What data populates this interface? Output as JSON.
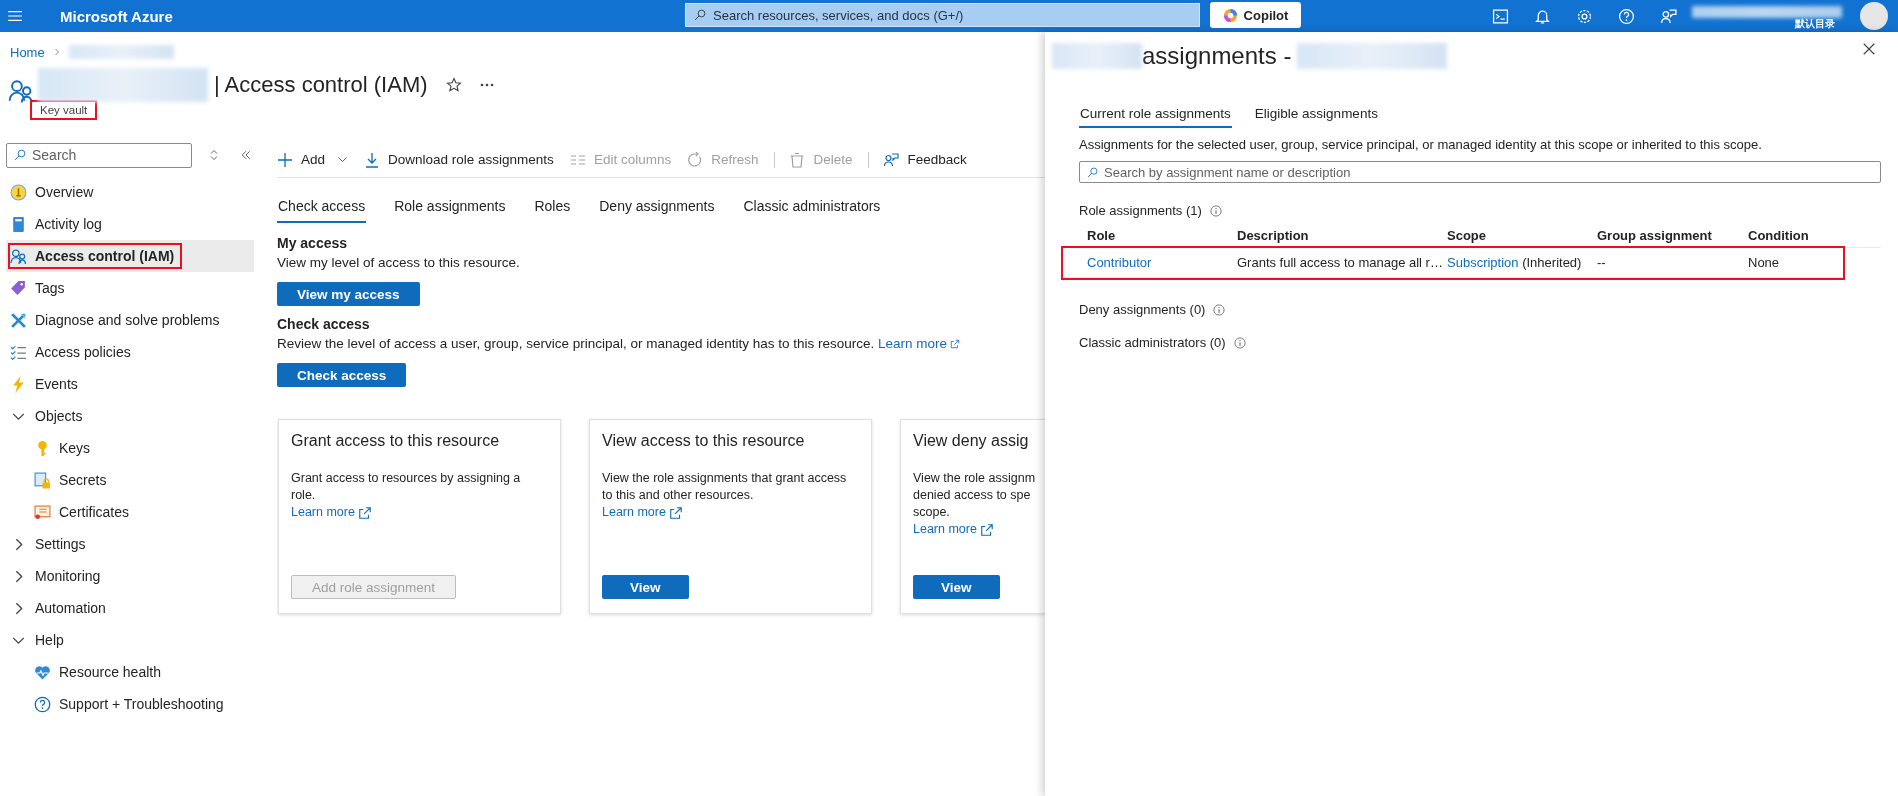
{
  "top_bar": {
    "brand": "Microsoft Azure",
    "search": {
      "placeholder": "Search resources, services, and docs (G+/)"
    },
    "copilot": "Copilot",
    "directory": "默认目录"
  },
  "breadcrumb": {
    "home": "Home"
  },
  "header": {
    "title": "| Access control (IAM)",
    "subtitle": "Key vault",
    "subtitle_highlighted": true
  },
  "sidebar": {
    "search": {
      "placeholder": "Search"
    },
    "items": [
      {
        "kind": "item",
        "label": "Overview",
        "selected": false,
        "highlighted": false
      },
      {
        "kind": "item",
        "label": "Activity log",
        "selected": false,
        "highlighted": false
      },
      {
        "kind": "item",
        "label": "Access control (IAM)",
        "selected": true,
        "highlighted": true
      },
      {
        "kind": "item",
        "label": "Tags",
        "selected": false,
        "highlighted": false
      },
      {
        "kind": "item",
        "label": "Diagnose and solve problems",
        "selected": false,
        "highlighted": false
      },
      {
        "kind": "item",
        "label": "Access policies",
        "selected": false,
        "highlighted": false
      },
      {
        "kind": "item",
        "label": "Events",
        "selected": false,
        "highlighted": false
      },
      {
        "kind": "group",
        "label": "Objects",
        "expanded": true,
        "children": [
          {
            "label": "Keys",
            "selected": false
          },
          {
            "label": "Secrets",
            "selected": false
          },
          {
            "label": "Certificates",
            "selected": false
          }
        ]
      },
      {
        "kind": "group",
        "label": "Settings",
        "expanded": false
      },
      {
        "kind": "group",
        "label": "Monitoring",
        "expanded": false
      },
      {
        "kind": "group",
        "label": "Automation",
        "expanded": false
      },
      {
        "kind": "group",
        "label": "Help",
        "expanded": true,
        "children": [
          {
            "label": "Resource health",
            "selected": false
          },
          {
            "label": "Support + Troubleshooting",
            "selected": false
          }
        ]
      }
    ]
  },
  "toolbar": [
    {
      "label": "Add",
      "disabled": false,
      "menu": true,
      "separator_before": false
    },
    {
      "label": "Download role assignments",
      "disabled": false,
      "menu": false,
      "separator_before": false
    },
    {
      "label": "Edit columns",
      "disabled": true,
      "menu": false,
      "separator_before": false
    },
    {
      "label": "Refresh",
      "disabled": true,
      "menu": false,
      "separator_before": false
    },
    {
      "label": "Delete",
      "disabled": true,
      "menu": false,
      "separator_before": true
    },
    {
      "label": "Feedback",
      "disabled": false,
      "menu": false,
      "separator_before": true
    }
  ],
  "tabs": [
    {
      "label": "Check access",
      "selected": true
    },
    {
      "label": "Role assignments",
      "selected": false
    },
    {
      "label": "Roles",
      "selected": false
    },
    {
      "label": "Deny assignments",
      "selected": false
    },
    {
      "label": "Classic administrators",
      "selected": false
    }
  ],
  "sections": [
    {
      "heading": "My access",
      "text": "View my level of access to this resource.",
      "button": "View my access"
    },
    {
      "heading": "Check access",
      "text": "Review the level of access a user, group, service principal, or managed identity has to this resource.",
      "link": "Learn more",
      "button": "Check access"
    }
  ],
  "cards": [
    {
      "title": "Grant access to this resource",
      "description_lines": [
        "Grant access to resources by assigning a",
        "role."
      ],
      "link": "Learn more",
      "button": {
        "label": "Add role assignment",
        "disabled": true
      }
    },
    {
      "title": "View access to this resource",
      "description_lines": [
        "View the role assignments that grant access",
        "to this and other resources."
      ],
      "link": "Learn more",
      "button": {
        "label": "View",
        "disabled": false
      }
    },
    {
      "title": "View deny assig",
      "description_lines": [
        "View the role assignm",
        "denied access to spe",
        "scope."
      ],
      "link": "Learn more",
      "button": {
        "label": "View",
        "disabled": false
      }
    }
  ],
  "panel": {
    "title": "assignments -",
    "tabs": [
      {
        "label": "Current role assignments",
        "selected": true
      },
      {
        "label": "Eligible assignments",
        "selected": false
      }
    ],
    "description": "Assignments for the selected user, group, service principal, or managed identity at this scope or inherited to this scope.",
    "search": {
      "placeholder": "Search by assignment name or description"
    },
    "role_assignments": {
      "label": "Role assignments (1)",
      "columns": [
        "Role",
        "Description",
        "Scope",
        "Group assignment",
        "Condition"
      ],
      "rows": [
        {
          "role": "Contributor",
          "description": "Grants full access to manage all r…",
          "scope": "Subscription",
          "scope_note": "(Inherited)",
          "group_assignment": "--",
          "condition": "None",
          "highlighted": true
        }
      ]
    },
    "summaries": [
      "Deny assignments (0)",
      "Classic administrators (0)"
    ]
  }
}
